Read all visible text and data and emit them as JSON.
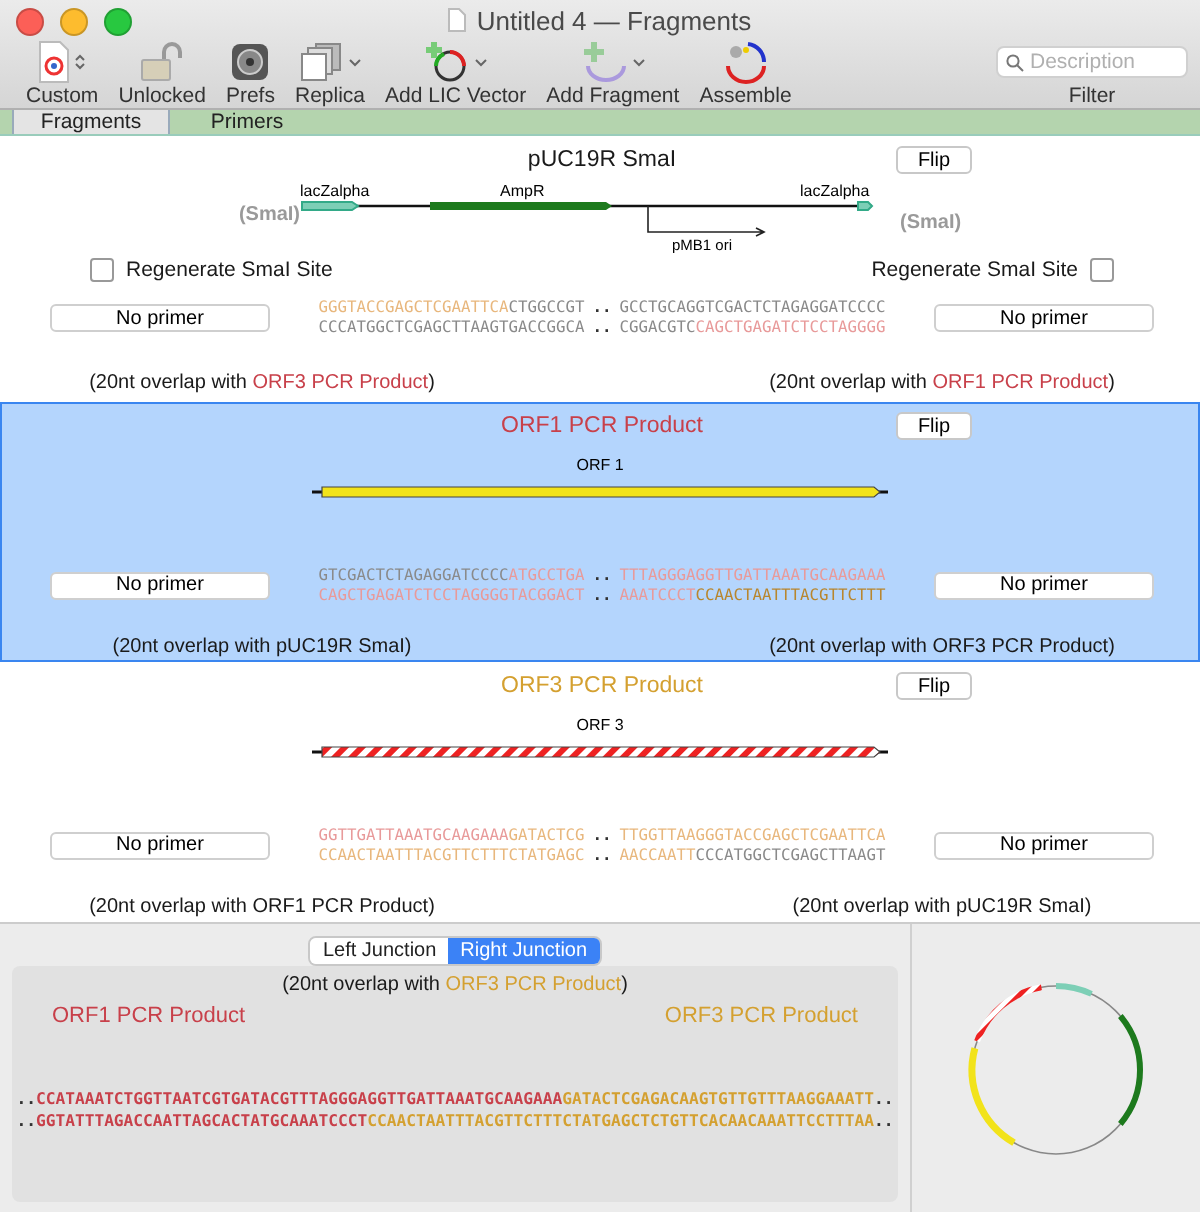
{
  "window": {
    "title": "Untitled 4 — Fragments"
  },
  "toolbar": {
    "items": [
      {
        "label": "Custom",
        "kind": "custom"
      },
      {
        "label": "Unlocked",
        "kind": "lock"
      },
      {
        "label": "Prefs",
        "kind": "prefs"
      },
      {
        "label": "Replica",
        "kind": "replica"
      },
      {
        "label": "Add LIC Vector",
        "kind": "vector"
      },
      {
        "label": "Add Fragment",
        "kind": "fragment"
      },
      {
        "label": "Assemble",
        "kind": "assemble"
      }
    ],
    "search": {
      "placeholder": "Description",
      "label": "Filter"
    }
  },
  "tabs": [
    {
      "label": "Fragments",
      "selected": true
    },
    {
      "label": "Primers",
      "selected": false
    }
  ],
  "fragments": [
    {
      "title": "pUC19R SmaI",
      "color": "#1a1a1a",
      "selected": false,
      "flip": "Flip",
      "map": {
        "kind": "vector",
        "labels": [
          "lacZalpha",
          "AmpR",
          "lacZalpha",
          "pMB1 ori"
        ],
        "sites": [
          "(SmaI)",
          "(SmaI)"
        ]
      },
      "checkboxes": [
        {
          "label": "Regenerate SmaI Site",
          "checked": false
        },
        {
          "label": "Regenerate SmaI Site",
          "checked": false
        }
      ],
      "rows": [
        {
          "left": [
            {
              "text": "GGGTACCGAGCTCGAATTCA",
              "color": "#e8b77d"
            },
            {
              "text": "CTGGCCGT",
              "color": "#8a8a8a"
            }
          ],
          "gap": "..",
          "right": [
            {
              "text": "GCCTGCAGGTCGACTCTAGAGGATCCCC",
              "color": "#8a8a8a"
            }
          ]
        },
        {
          "left": [
            {
              "text": "CCCATGGCTCGAGCTTAAGTGACCGGCA",
              "color": "#8a8a8a"
            }
          ],
          "gap": "..",
          "right": [
            {
              "text": "CGGACGTC",
              "color": "#8a8a8a"
            },
            {
              "text": "CAGCTGAGATCTCCTAGGGG",
              "color": "#e89a9a"
            }
          ]
        }
      ],
      "primers": [
        "No primer",
        "No primer"
      ],
      "overlaps": [
        {
          "prefix": "(20nt overlap with ",
          "name": "ORF3 PCR Product",
          "color": "#c8404a",
          "suffix": ")"
        },
        {
          "prefix": "(20nt overlap with ",
          "name": "ORF1 PCR Product",
          "color": "#c8404a",
          "suffix": ")"
        }
      ]
    },
    {
      "title": "ORF1 PCR Product",
      "color": "#c8404a",
      "selected": true,
      "flip": "Flip",
      "map": {
        "kind": "solid-orf",
        "labels": [
          "ORF 1"
        ]
      },
      "rows": [
        {
          "left": [
            {
              "text": "GTCGACTCTAGAGGATCCCC",
              "color": "#8a8a8a"
            },
            {
              "text": "ATGCCTGA",
              "color": "#e89a9a"
            }
          ],
          "gap": "..",
          "right": [
            {
              "text": "TTTAGGGAGGTTGATTAAATGCAAGAAA",
              "color": "#e89a9a"
            }
          ]
        },
        {
          "left": [
            {
              "text": "CAGCTGAGATCTCCTAGGGGTACGGACT",
              "color": "#e89a9a"
            }
          ],
          "gap": "..",
          "right": [
            {
              "text": "AAATCCCT",
              "color": "#e89a9a"
            },
            {
              "text": "CCAACTAATTTACGTTCTTT",
              "color": "#b8862e"
            }
          ]
        }
      ],
      "primers": [
        "No primer",
        "No primer"
      ],
      "overlaps": [
        {
          "prefix": "(20nt overlap with ",
          "name": "pUC19R SmaI",
          "color": "#1a1a1a",
          "suffix": ")"
        },
        {
          "prefix": "(20nt overlap with ",
          "name": "ORF3 PCR Product",
          "color": "#1a1a1a",
          "suffix": ")"
        }
      ]
    },
    {
      "title": "ORF3 PCR Product",
      "color": "#d4a030",
      "selected": false,
      "flip": "Flip",
      "map": {
        "kind": "striped-orf",
        "labels": [
          "ORF 3"
        ]
      },
      "rows": [
        {
          "left": [
            {
              "text": "GGTTGATTAAATGCAAGAAA",
              "color": "#e89a9a"
            },
            {
              "text": "GATACTCG",
              "color": "#e8b77d"
            }
          ],
          "gap": "..",
          "right": [
            {
              "text": "TTGGTTAAGGGTACCGAGCTCGAATTCA",
              "color": "#e8b77d"
            }
          ]
        },
        {
          "left": [
            {
              "text": "CCAACTAATTTACGTTCTTTCTATGAGC",
              "color": "#e8b77d"
            }
          ],
          "gap": "..",
          "right": [
            {
              "text": "AACCAATT",
              "color": "#e8b77d"
            },
            {
              "text": "CCCATGGCTCGAGCTTAAGT",
              "color": "#8a8a8a"
            }
          ]
        }
      ],
      "primers": [
        "No primer",
        "No primer"
      ],
      "overlaps": [
        {
          "prefix": "(20nt overlap with ",
          "name": "ORF1 PCR Product",
          "color": "#1a1a1a",
          "suffix": ")"
        },
        {
          "prefix": "(20nt overlap with ",
          "name": "pUC19R SmaI",
          "color": "#1a1a1a",
          "suffix": ")"
        }
      ]
    }
  ],
  "junction": {
    "segments": [
      {
        "label": "Left Junction",
        "selected": false
      },
      {
        "label": "Right Junction",
        "selected": true
      }
    ],
    "overlap": {
      "prefix": "(20nt overlap with ",
      "name": "ORF3 PCR Product",
      "color": "#d4a030",
      "suffix": ")"
    },
    "left_name": {
      "text": "ORF1 PCR Product",
      "color": "#c8404a"
    },
    "right_name": {
      "text": "ORF3 PCR Product",
      "color": "#d4a030"
    },
    "lines": [
      {
        "start": "..",
        "segments": [
          {
            "text": "CCATAAATCTGGTTAATCGTGATACGTTTAGGGAGGTTGATTAAATGCAAGAAA",
            "color": "#c8404a"
          },
          {
            "text": "GATACTCGAGACAAGTGTTGTTTAAGGAAATT",
            "color": "#d4a030"
          }
        ],
        "end": ".."
      },
      {
        "start": "..",
        "segments": [
          {
            "text": "GGTATTTAGACCAATTAGCACTATGCAAATCCCT",
            "color": "#c8404a"
          },
          {
            "text": "CCAACTAATTTACGTTCTTTCTATGAGCTCTGTTCACAACAAATTCCTTTAA",
            "color": "#d4a030"
          }
        ],
        "end": ".."
      }
    ]
  }
}
